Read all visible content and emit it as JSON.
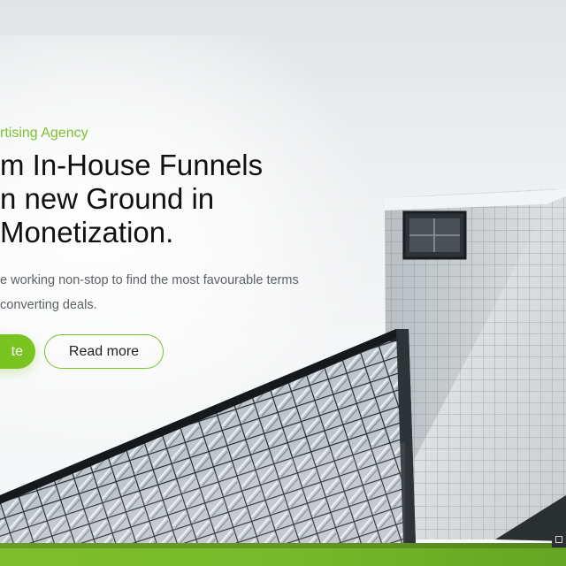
{
  "hero": {
    "eyebrow": "rtising Agency",
    "headline": [
      "m In-House Funnels",
      "n new Ground in",
      "Monetization."
    ],
    "description": [
      "e working non-stop to find the most favourable terms",
      "converting deals."
    ],
    "primary_button": "te",
    "secondary_button": "Read more"
  },
  "colors": {
    "accent": "#7cc22c",
    "headline": "#111111",
    "body_text": "#5d6166",
    "footer_strip": "#77b92a"
  }
}
